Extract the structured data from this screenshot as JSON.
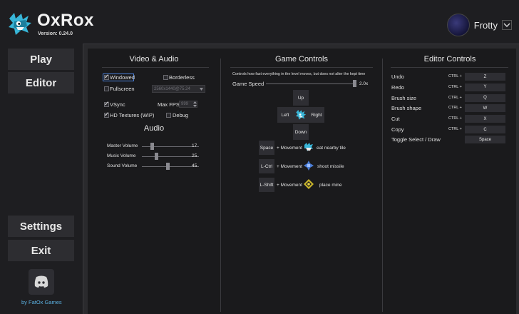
{
  "header": {
    "brand": "OxRox",
    "version": "Version: 0.24.0",
    "username": "Frotty"
  },
  "sidebar": {
    "play": "Play",
    "editor": "Editor",
    "settings": "Settings",
    "exit": "Exit",
    "credit": "by FatOx Games"
  },
  "video": {
    "title": "Video & Audio",
    "windowed": "Windowed",
    "windowed_checked": true,
    "borderless": "Borderless",
    "borderless_checked": false,
    "fullscreen": "Fullscreen",
    "fullscreen_checked": false,
    "resolution": "2560x1440@75.24",
    "vsync": "VSync",
    "vsync_checked": true,
    "max_fps_label": "Max FPS",
    "max_fps": "999",
    "hd_textures": "HD Textures (WIP)",
    "hd_textures_checked": true,
    "debug": "Debug",
    "debug_checked": false
  },
  "audio": {
    "title": "Audio",
    "sliders": [
      {
        "label": "Master Volume",
        "value": "17",
        "fraction": 0.17
      },
      {
        "label": "Music Volume",
        "value": "25",
        "fraction": 0.25
      },
      {
        "label": "Sound Volume",
        "value": "45",
        "fraction": 0.45
      }
    ]
  },
  "game": {
    "title": "Game Controls",
    "description": "Controls how fast everything in the level moves, but does not alter the kept time",
    "speed_label": "Game Speed",
    "speed_value": "2.0x",
    "speed_fraction": 1.0,
    "up": "Up",
    "left": "Left",
    "right": "Right",
    "down": "Down",
    "movement": "+ Movement",
    "actions": [
      {
        "key": "Space",
        "action": "eat nearby tile",
        "icon": "eat-icon"
      },
      {
        "key": "L-Ctrl",
        "action": "shoot missile",
        "icon": "missile-icon"
      },
      {
        "key": "L-Shift",
        "action": "place mine",
        "icon": "mine-icon"
      }
    ]
  },
  "editor": {
    "title": "Editor Controls",
    "ctrl": "CTRL +",
    "bindings": [
      {
        "label": "Undo",
        "key": "Z"
      },
      {
        "label": "Redo",
        "key": "Y"
      },
      {
        "label": "Brush size",
        "key": "Q"
      },
      {
        "label": "Brush shape",
        "key": "W"
      },
      {
        "label": "Cut",
        "key": "X"
      },
      {
        "label": "Copy",
        "key": "C"
      }
    ],
    "toggle_label": "Toggle Select / Draw",
    "toggle_key": "Space"
  }
}
